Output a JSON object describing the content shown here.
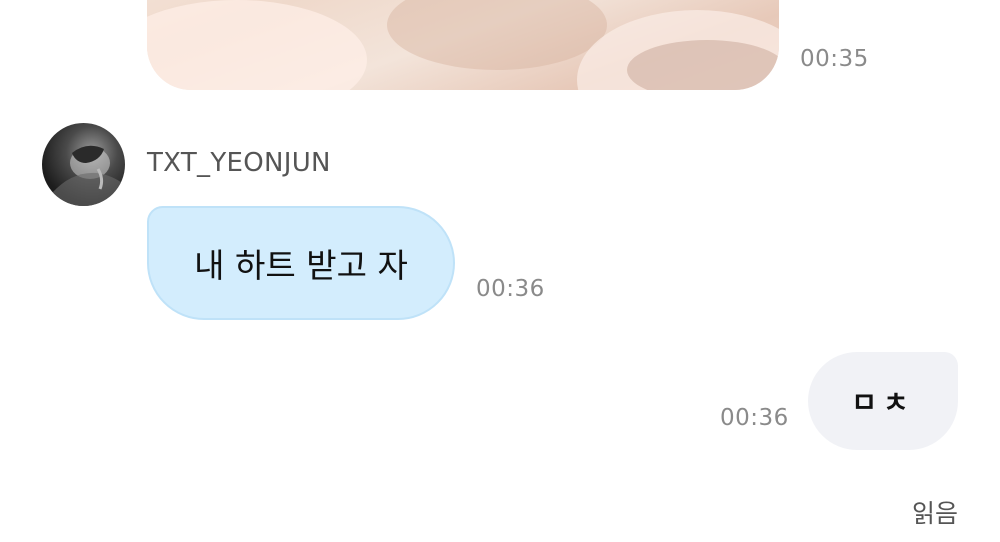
{
  "chat": {
    "previous_image_message": {
      "time": "00:35"
    },
    "incoming": {
      "sender": "TXT_YEONJUN",
      "text": "내 하트 받고 자",
      "time": "00:36"
    },
    "outgoing": {
      "text": "ㅁㅊ",
      "time": "00:36",
      "read_status": "읽음"
    }
  },
  "colors": {
    "incoming_bubble": "#d3edfd",
    "incoming_bubble_border": "#bfe2f8",
    "outgoing_bubble": "#f1f2f6",
    "timestamp": "#8a8a8a",
    "sender_name": "#555555"
  }
}
